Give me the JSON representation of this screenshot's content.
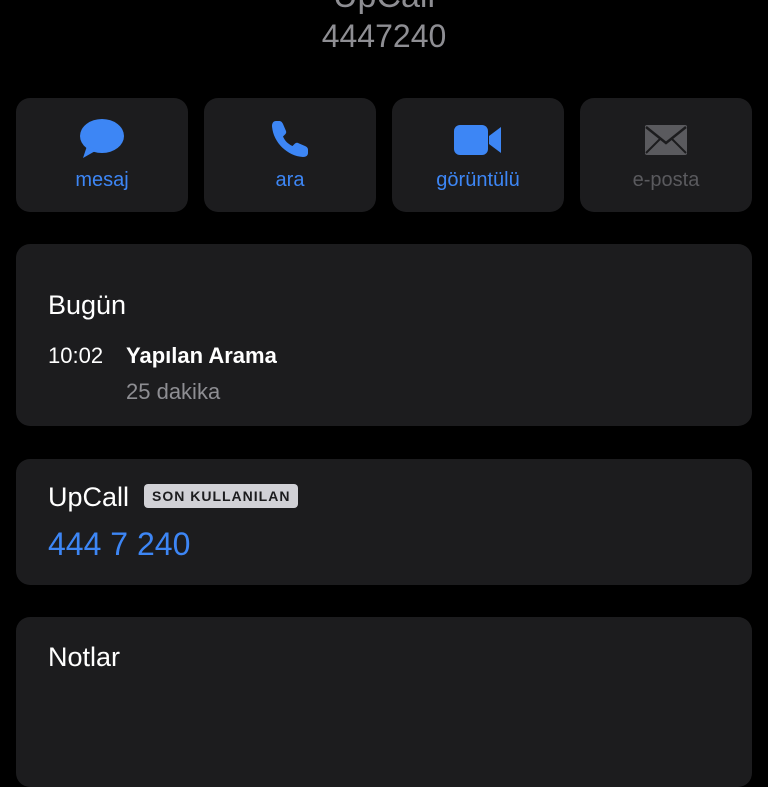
{
  "contact": {
    "name": "UpCall",
    "number": "4447240"
  },
  "actions": [
    {
      "label": "mesaj",
      "icon": "message-bubble-icon",
      "enabled": true
    },
    {
      "label": "ara",
      "icon": "phone-icon",
      "enabled": true
    },
    {
      "label": "görüntülü",
      "icon": "video-camera-icon",
      "enabled": true
    },
    {
      "label": "e-posta",
      "icon": "envelope-icon",
      "enabled": false
    }
  ],
  "recents": {
    "title": "Bugün",
    "calls": [
      {
        "time": "10:02",
        "type": "Yapılan Arama",
        "duration": "25 dakika"
      }
    ]
  },
  "phone": {
    "label": "UpCall",
    "badge": "SON KULLANILAN",
    "number": "444 7 240"
  },
  "notes": {
    "title": "Notlar"
  },
  "colors": {
    "accent": "#3d86f5",
    "background": "#000000",
    "card": "#1c1c1e",
    "secondary_text": "#8e8e93",
    "disabled": "#5a5a5e"
  }
}
